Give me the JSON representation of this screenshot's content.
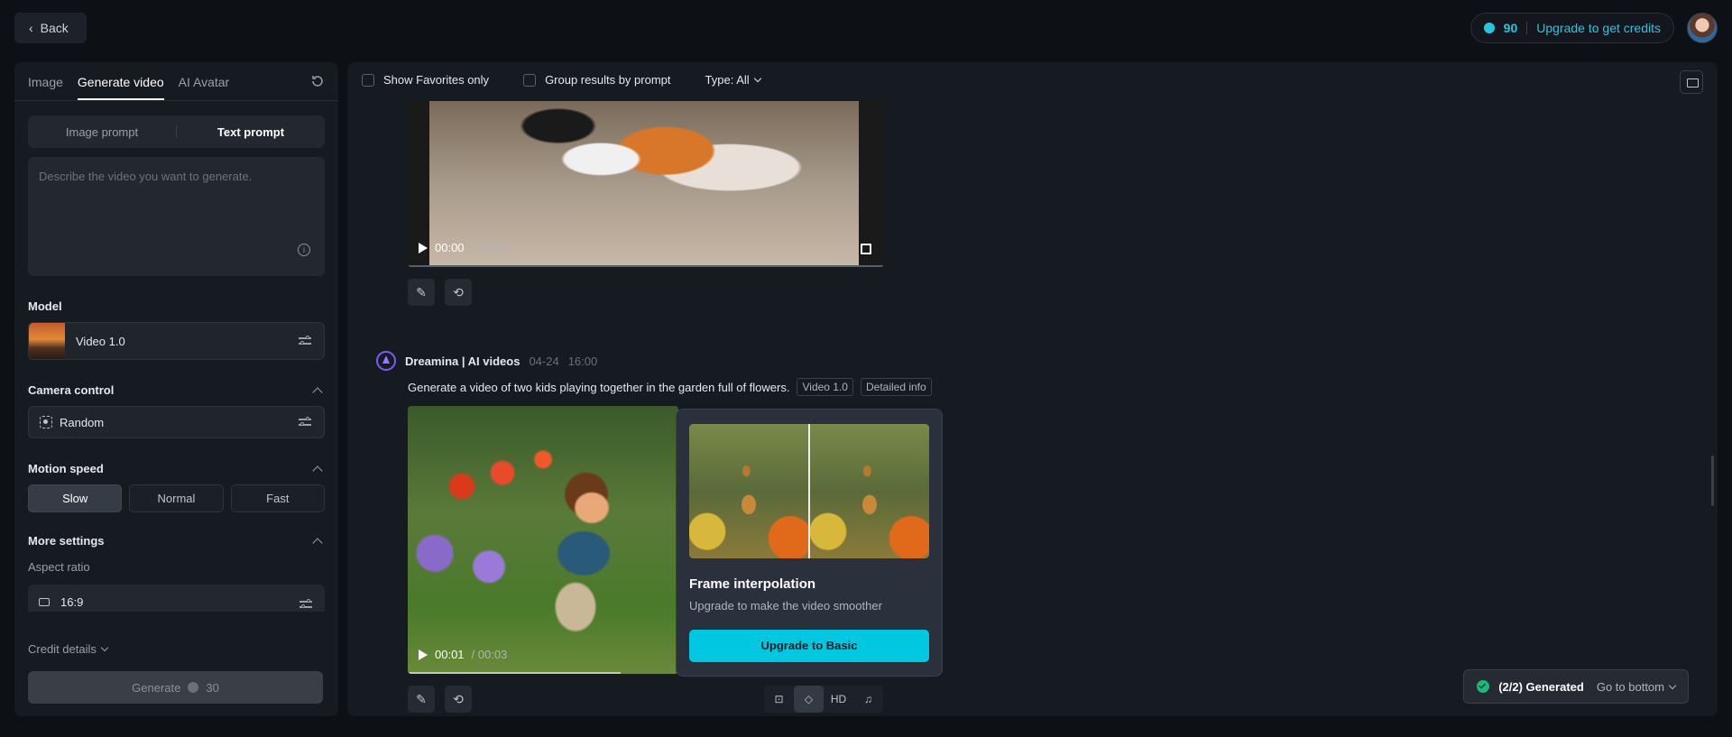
{
  "header": {
    "back_label": "Back",
    "credits": "90",
    "upgrade_label": "Upgrade to get credits"
  },
  "sidebar": {
    "tabs": [
      {
        "label": "Image"
      },
      {
        "label": "Generate video"
      },
      {
        "label": "AI Avatar"
      }
    ],
    "prompt_modes": [
      {
        "label": "Image prompt"
      },
      {
        "label": "Text prompt"
      }
    ],
    "prompt_placeholder": "Describe the video you want to generate.",
    "model_label": "Model",
    "model_value": "Video 1.0",
    "camera_label": "Camera control",
    "camera_value": "Random",
    "motion_label": "Motion speed",
    "motion_options": [
      {
        "label": "Slow"
      },
      {
        "label": "Normal"
      },
      {
        "label": "Fast"
      }
    ],
    "more_settings_label": "More settings",
    "aspect_label": "Aspect ratio",
    "aspect_value": "16:9",
    "credit_details_label": "Credit details",
    "generate_label": "Generate",
    "generate_cost": "30"
  },
  "toolbar": {
    "favorites_label": "Show Favorites only",
    "group_label": "Group results by prompt",
    "type_label": "Type: All"
  },
  "video1": {
    "current_time": "00:00",
    "total_time": "/ 00:03"
  },
  "post": {
    "author": "Dreamina | AI videos",
    "date": "04-24",
    "time": "16:00",
    "prompt": "Generate a video of two kids playing together in the garden full of flowers.",
    "tags": [
      {
        "label": "Video 1.0"
      },
      {
        "label": "Detailed info"
      }
    ]
  },
  "video2": {
    "current_time": "00:01",
    "total_time": "/ 00:03",
    "hd_label": "HD"
  },
  "popup": {
    "title": "Frame interpolation",
    "subtitle": "Upgrade to make the video smoother",
    "button_label": "Upgrade to Basic"
  },
  "status": {
    "generated_label": "(2/2) Generated",
    "go_bottom_label": "Go to bottom"
  },
  "colors": {
    "accent": "#22c8e0",
    "primary_button": "#00c8e0",
    "success": "#1ab87a",
    "brand": "#7a5af8"
  }
}
